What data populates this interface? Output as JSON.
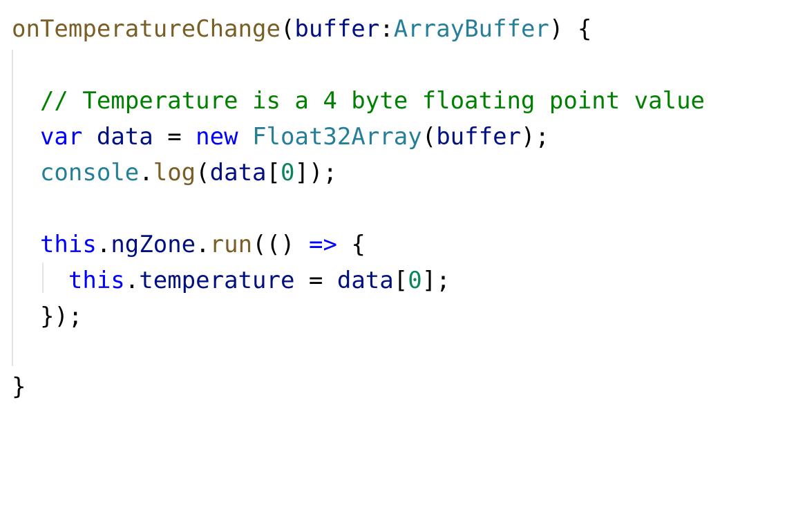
{
  "code": {
    "line1": {
      "fn_name": "onTemperatureChange",
      "open_paren": "(",
      "param": "buffer",
      "colon": ":",
      "type": "ArrayBuffer",
      "close": ") {"
    },
    "line3": {
      "comment": "// Temperature is a 4 byte floating point value"
    },
    "line4": {
      "kw_var": "var",
      "var_name": "data",
      "eq": " = ",
      "kw_new": "new",
      "type": "Float32Array",
      "open_paren": "(",
      "arg": "buffer",
      "close": ");"
    },
    "line5": {
      "obj": "console",
      "dot": ".",
      "method": "log",
      "open_paren": "(",
      "arg": "data",
      "open_bracket": "[",
      "index": "0",
      "close": "]);"
    },
    "line7": {
      "kw_this": "this",
      "dot1": ".",
      "prop": "ngZone",
      "dot2": ".",
      "method": "run",
      "parens": "(()",
      "arrow": "=>",
      "brace": "{"
    },
    "line8": {
      "kw_this": "this",
      "dot": ".",
      "prop": "temperature",
      "eq": " = ",
      "arg": "data",
      "open_bracket": "[",
      "index": "0",
      "close": "];"
    },
    "line9": {
      "close": "});"
    },
    "line11": {
      "close": "}"
    }
  },
  "colors": {
    "function": "#795e26",
    "parameter": "#001080",
    "type": "#267f99",
    "keyword": "#0000ff",
    "comment": "#008000",
    "number": "#098658",
    "punctuation": "#000000",
    "indent_guide": "#e4e4e4"
  }
}
